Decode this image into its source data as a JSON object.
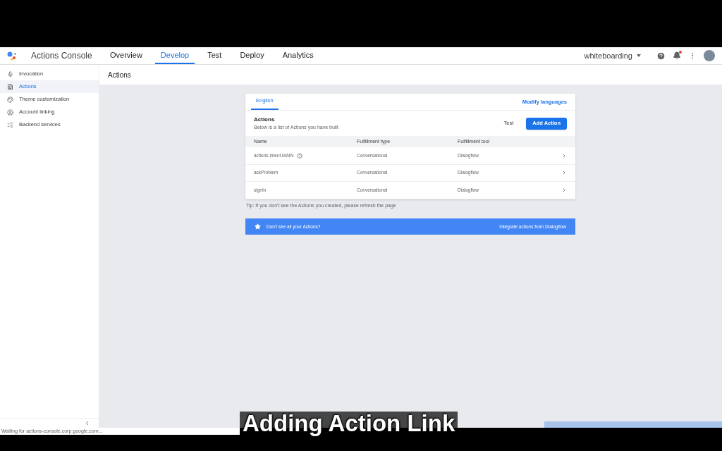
{
  "app": {
    "title": "Actions Console",
    "project": "whiteboarding"
  },
  "nav_tabs": [
    {
      "label": "Overview",
      "selected": false
    },
    {
      "label": "Develop",
      "selected": true
    },
    {
      "label": "Test",
      "selected": false
    },
    {
      "label": "Deploy",
      "selected": false
    },
    {
      "label": "Analytics",
      "selected": false
    }
  ],
  "notifications": {
    "unread": true
  },
  "sidebar": {
    "items": [
      {
        "label": "Invocation",
        "selected": false
      },
      {
        "label": "Actions",
        "selected": true
      },
      {
        "label": "Theme customization",
        "selected": false
      },
      {
        "label": "Account linking",
        "selected": false
      },
      {
        "label": "Backend services",
        "selected": false
      }
    ]
  },
  "page_title": "Actions",
  "card": {
    "language_tabs": [
      {
        "label": "English",
        "selected": true
      }
    ],
    "modify_link": "Modify languages",
    "heading": "Actions",
    "subheading": "Below is a list of Actions you have built",
    "test_button": "Test",
    "add_button": "Add Action",
    "columns": [
      "Name",
      "Fulfillment type",
      "Fulfillment tool"
    ],
    "rows": [
      {
        "name": "actions.intent.MAIN",
        "help": true,
        "type": "Conversational",
        "tool": "Dialogflow"
      },
      {
        "name": "askProblem",
        "help": false,
        "type": "Conversational",
        "tool": "Dialogflow"
      },
      {
        "name": "signIn",
        "help": false,
        "type": "Conversational",
        "tool": "Dialogflow"
      }
    ]
  },
  "tip": "Tip: If you don't see the Actions you created, please refresh the page",
  "banner": {
    "text": "Don't see all your Actions?",
    "link": "Integrate actions from Dialogflow"
  },
  "status_bar": "Waiting for actions-console.corp.google.com...",
  "caption": "Adding Action Link"
}
